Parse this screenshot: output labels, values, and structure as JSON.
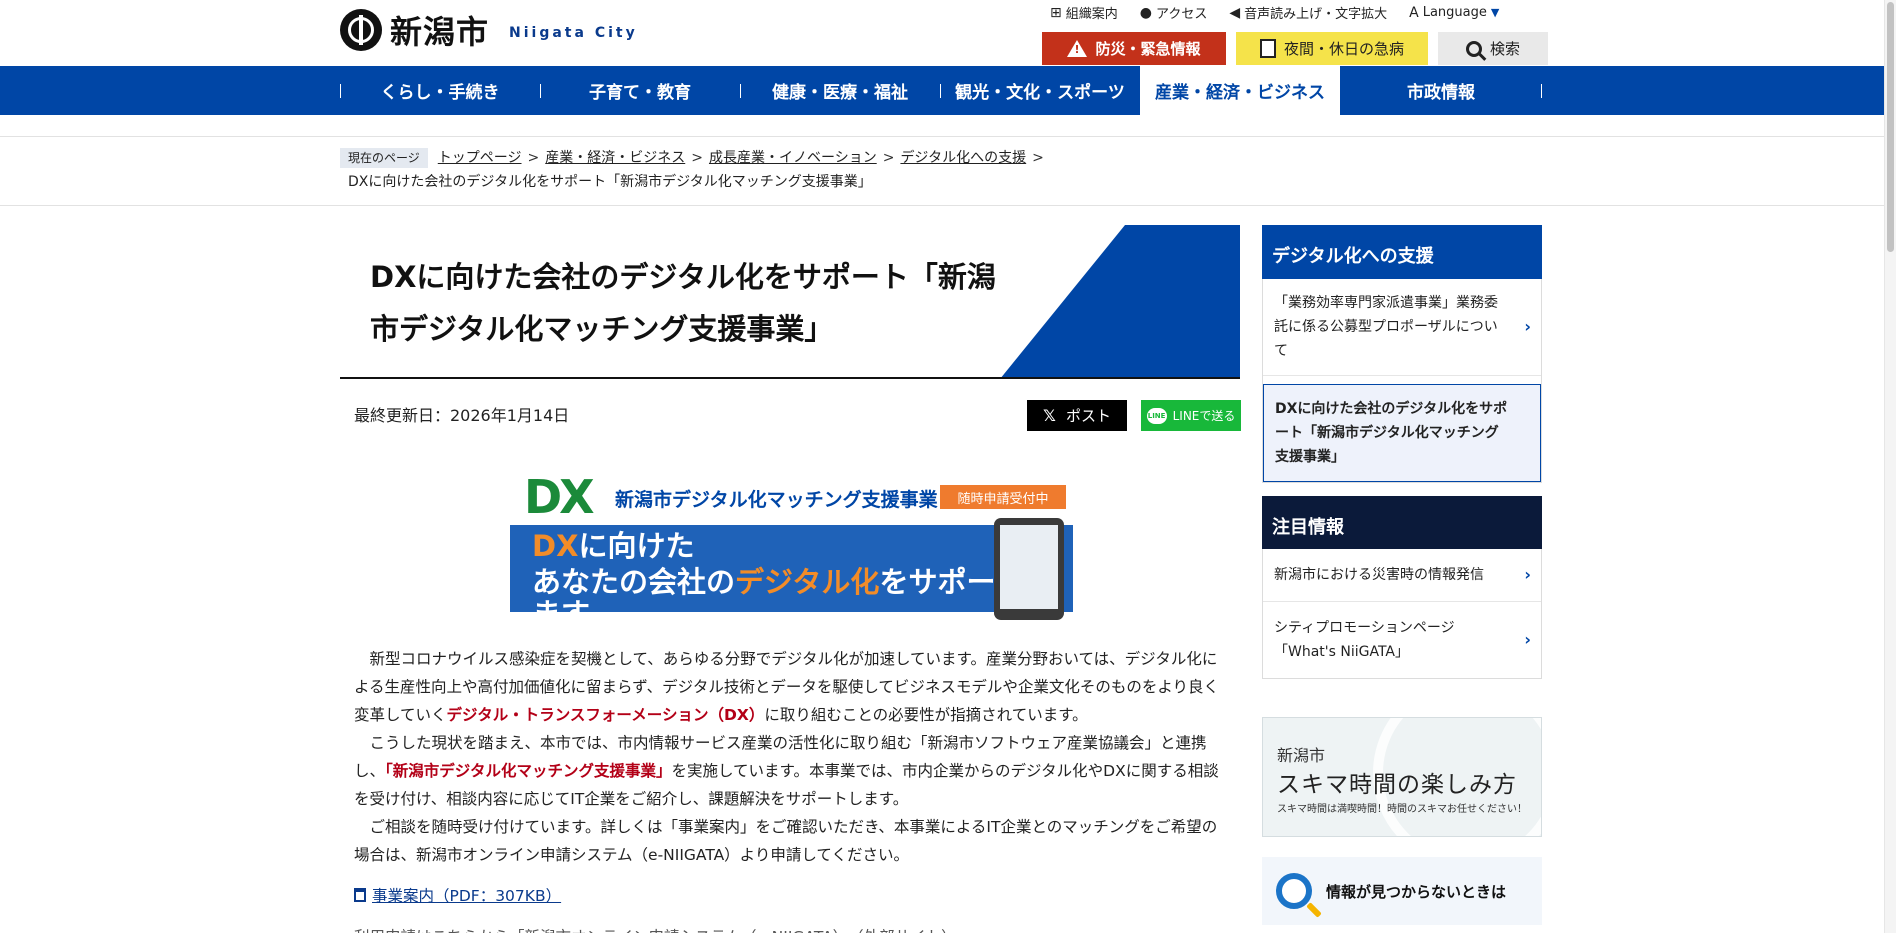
{
  "header": {
    "logo_jp": "新潟市",
    "logo_en": "Niigata City",
    "util": {
      "org": "組織案内",
      "access": "アクセス",
      "voice": "音声読み上げ・文字拡大",
      "language": "Language"
    },
    "buttons": {
      "emergency": "防災・緊急情報",
      "night": "夜間・休日の急病",
      "search": "検索"
    }
  },
  "nav": {
    "items": [
      "くらし・手続き",
      "子育て・教育",
      "健康・医療・福祉",
      "観光・文化・スポーツ",
      "産業・経済・ビジネス",
      "市政情報"
    ]
  },
  "breadcrumb": {
    "here": "現在のページ",
    "links": [
      "トップページ",
      "産業・経済・ビジネス",
      "成長産業・イノベーション",
      "デジタル化への支援"
    ],
    "current": "DXに向けた会社のデジタル化をサポート「新潟市デジタル化マッチング支援事業」"
  },
  "page": {
    "title": "DXに向けた会社のデジタル化をサポート「新潟市デジタル化マッチング支援事業」",
    "updated": "最終更新日：2026年1月14日",
    "sns_x": "ポスト",
    "sns_line": "LINEで送る",
    "sns_line_icon": "LINE"
  },
  "banner": {
    "logo": "DX",
    "subtitle": "新潟市デジタル化マッチング支援事業",
    "tag": "随時申請受付中",
    "line1_a": "DX",
    "line1_b": "に向けた",
    "line2_a": "あなたの会社の",
    "line2_b": "デジタル化",
    "line2_c": "をサポートします"
  },
  "body": {
    "p1_a": "新型コロナウイルス感染症を契機として、あらゆる分野でデジタル化が加速しています。産業分野おいては、デジタル化による生産性向上や高付加価値化に留まらず、デジタル技術とデータを駆使してビジネスモデルや企業文化そのものをより良く変革していく",
    "p1_em": "デジタル・トランスフォーメーション（DX）",
    "p1_b": "に取り組むことの必要性が指摘されています。",
    "p2_a": "こうした現状を踏まえ、本市では、市内情報サービス産業の活性化に取り組む「新潟市ソフトウェア産業協議会」と連携し、",
    "p2_em": "「新潟市デジタル化マッチング支援事業」",
    "p2_b": "を実施しています。本事業では、市内企業からのデジタル化やDXに関する相談を受け付け、相談内容に応じてIT企業をご紹介し、課題解決をサポートします。",
    "p3": "ご相談を随時受け付けています。詳しくは「事業案内」をご確認いただき、本事業によるIT企業とのマッチングをご希望の場合は、新潟市オンライン申請システム（e-NIIGATA）より申請してください。",
    "pdf_link": "事業案内（PDF：307KB）",
    "next_line": "利用申請はこちらから「新潟市オンライン申請システム（e-NIIGATA）」（外部サイト）"
  },
  "sidebar": {
    "section_title": "デジタル化への支援",
    "items": [
      "「業務効率専門家派遣事業」業務委託に係る公募型プロポーザルについて",
      "DXに向けた会社のデジタル化をサポート「新潟市デジタル化マッチング支援事業」"
    ],
    "featured_title": "注目情報",
    "featured": [
      "新潟市における災害時の情報発信",
      "シティプロモーションページ「What's NiiGATA」"
    ],
    "sukima_l1": "新潟市",
    "sukima_l2": "スキマ時間の楽しみ方",
    "sukima_l3": "スキマ時間は満喫時間！時間のスキマお任せください！",
    "notfound": "情報が見つからないときは"
  },
  "colors": {
    "primary": "#0046a6",
    "emergency": "#c3311a",
    "night": "#f5e34a",
    "line": "#18b83a",
    "emphasis": "#b30017"
  }
}
